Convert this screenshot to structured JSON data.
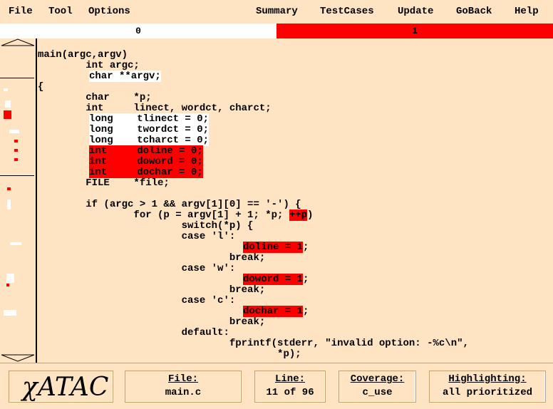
{
  "menu": {
    "file": "File",
    "tool": "Tool",
    "options": "Options",
    "summary": "Summary",
    "testcases": "TestCases",
    "update": "Update",
    "goback": "GoBack",
    "help": "Help"
  },
  "counts": {
    "left": "0",
    "right": "1"
  },
  "code": {
    "l1": "main(argc,argv)",
    "l2": "        int argc;",
    "l3": "char **argv;",
    "l4": "{",
    "l5": "        char    *p;",
    "l6": "        int     linect, wordct, charct;",
    "l7": "long    tlinect = 0;",
    "l8": "long    twordct = 0;",
    "l9": "long    tcharct = 0;",
    "l10": "int     doline = 0;",
    "l11": "int     doword = 0;",
    "l12": "int     dochar = 0;",
    "l13": "        FILE    *file;",
    "l14": "        if (argc > 1 && argv[1][0] == '-') {",
    "l15a": "                for (p = argv[1] + 1; *p; ",
    "l15b": "++p",
    "l15c": ")",
    "l16": "                        switch(*p) {",
    "l17": "                        case 'l':",
    "l18": "doline = 1",
    "l18s": ";",
    "l19": "                                break;",
    "l20": "                        case 'w':",
    "l21": "doword = 1",
    "l21s": ";",
    "l22": "                                break;",
    "l23": "                        case 'c':",
    "l24": "dochar = 1",
    "l24s": ";",
    "l25": "                                break;",
    "l26": "                        default:",
    "l27": "                                fprintf(stderr, \"invalid option: -%c\\n\",",
    "l28": "                                        *p);"
  },
  "status": {
    "logo": "χATAC",
    "file_label": "File:",
    "file_value": "main.c",
    "line_label": "Line:",
    "line_value": "11 of 96",
    "coverage_label": "Coverage:",
    "coverage_value": "c_use",
    "highlight_label": "Highlighting:",
    "highlight_value": "all prioritized"
  },
  "colors": {
    "background": "#ffe4c4",
    "uncovered": "#ff0000",
    "covered": "#ffffff"
  },
  "icons": {
    "scroll_up": "triangle-up-icon",
    "scroll_down": "triangle-down-icon"
  }
}
